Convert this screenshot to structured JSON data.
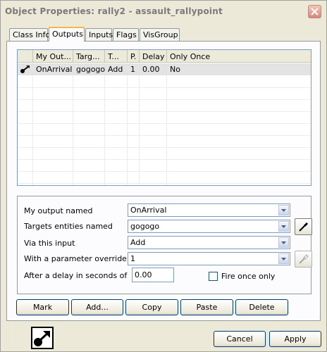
{
  "window": {
    "title": "Object Properties: rally2 - assault_rallypoint"
  },
  "tabs": [
    {
      "label": "Class Info"
    },
    {
      "label": "Outputs"
    },
    {
      "label": "Inputs"
    },
    {
      "label": "Flags"
    },
    {
      "label": "VisGroup"
    }
  ],
  "active_tab": "Outputs",
  "outputs_list": {
    "columns": [
      "My Out...",
      "Targ...",
      "T...",
      "P.",
      "Delay",
      "Only Once"
    ],
    "rows": [
      {
        "output": "OnArrival",
        "target": "gogogo",
        "input": "Add",
        "param": "1",
        "delay": "0.00",
        "once": "No"
      }
    ]
  },
  "form": {
    "output_label": "My output named",
    "output_value": "OnArrival",
    "targets_label": "Targets entities named",
    "targets_value": "gogogo",
    "input_label": "Via this input",
    "input_value": "Add",
    "param_label": "With a parameter override of",
    "param_value": "1",
    "delay_label": "After a delay in seconds of",
    "delay_value": "0.00",
    "fire_once_label": "Fire once only",
    "fire_once_checked": false
  },
  "action_buttons": {
    "mark": "Mark",
    "add": "Add...",
    "copy": "Copy",
    "paste": "Paste",
    "delete": "Delete"
  },
  "dialog_buttons": {
    "cancel": "Cancel",
    "apply": "Apply"
  },
  "icons": {
    "row_icon": "output-connection-icon",
    "big_icon": "output-connection-icon",
    "eyedropper": "eyedropper-icon"
  },
  "colors": {
    "face": "#ece9d8",
    "active_tab_accent": "#f6b64a",
    "selected_row": "#e3e3e3",
    "border_blue": "#7f9db9"
  }
}
